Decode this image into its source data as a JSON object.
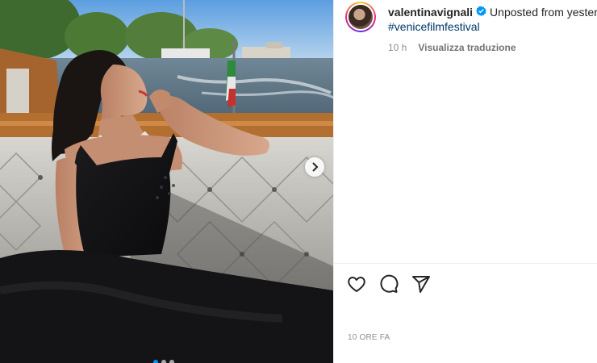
{
  "post": {
    "username": "valentinavignali",
    "caption_text": "Unposted from yesterday",
    "hashtag": "#venicefilmfestival",
    "time_ago": "10 h",
    "translate_label": "Visualizza traduzione",
    "posted_label": "10 ORE FA"
  },
  "carousel": {
    "slide_count": 3,
    "active_index": 0
  },
  "icons": {
    "like": "heart-icon",
    "comment": "comment-icon",
    "share": "paper-plane-icon",
    "verified": "verified-badge-icon",
    "next": "chevron-right-icon"
  },
  "colors": {
    "verified_blue": "#0095f6",
    "hashtag_blue": "#00376b",
    "muted_text": "#8e8e8e"
  }
}
